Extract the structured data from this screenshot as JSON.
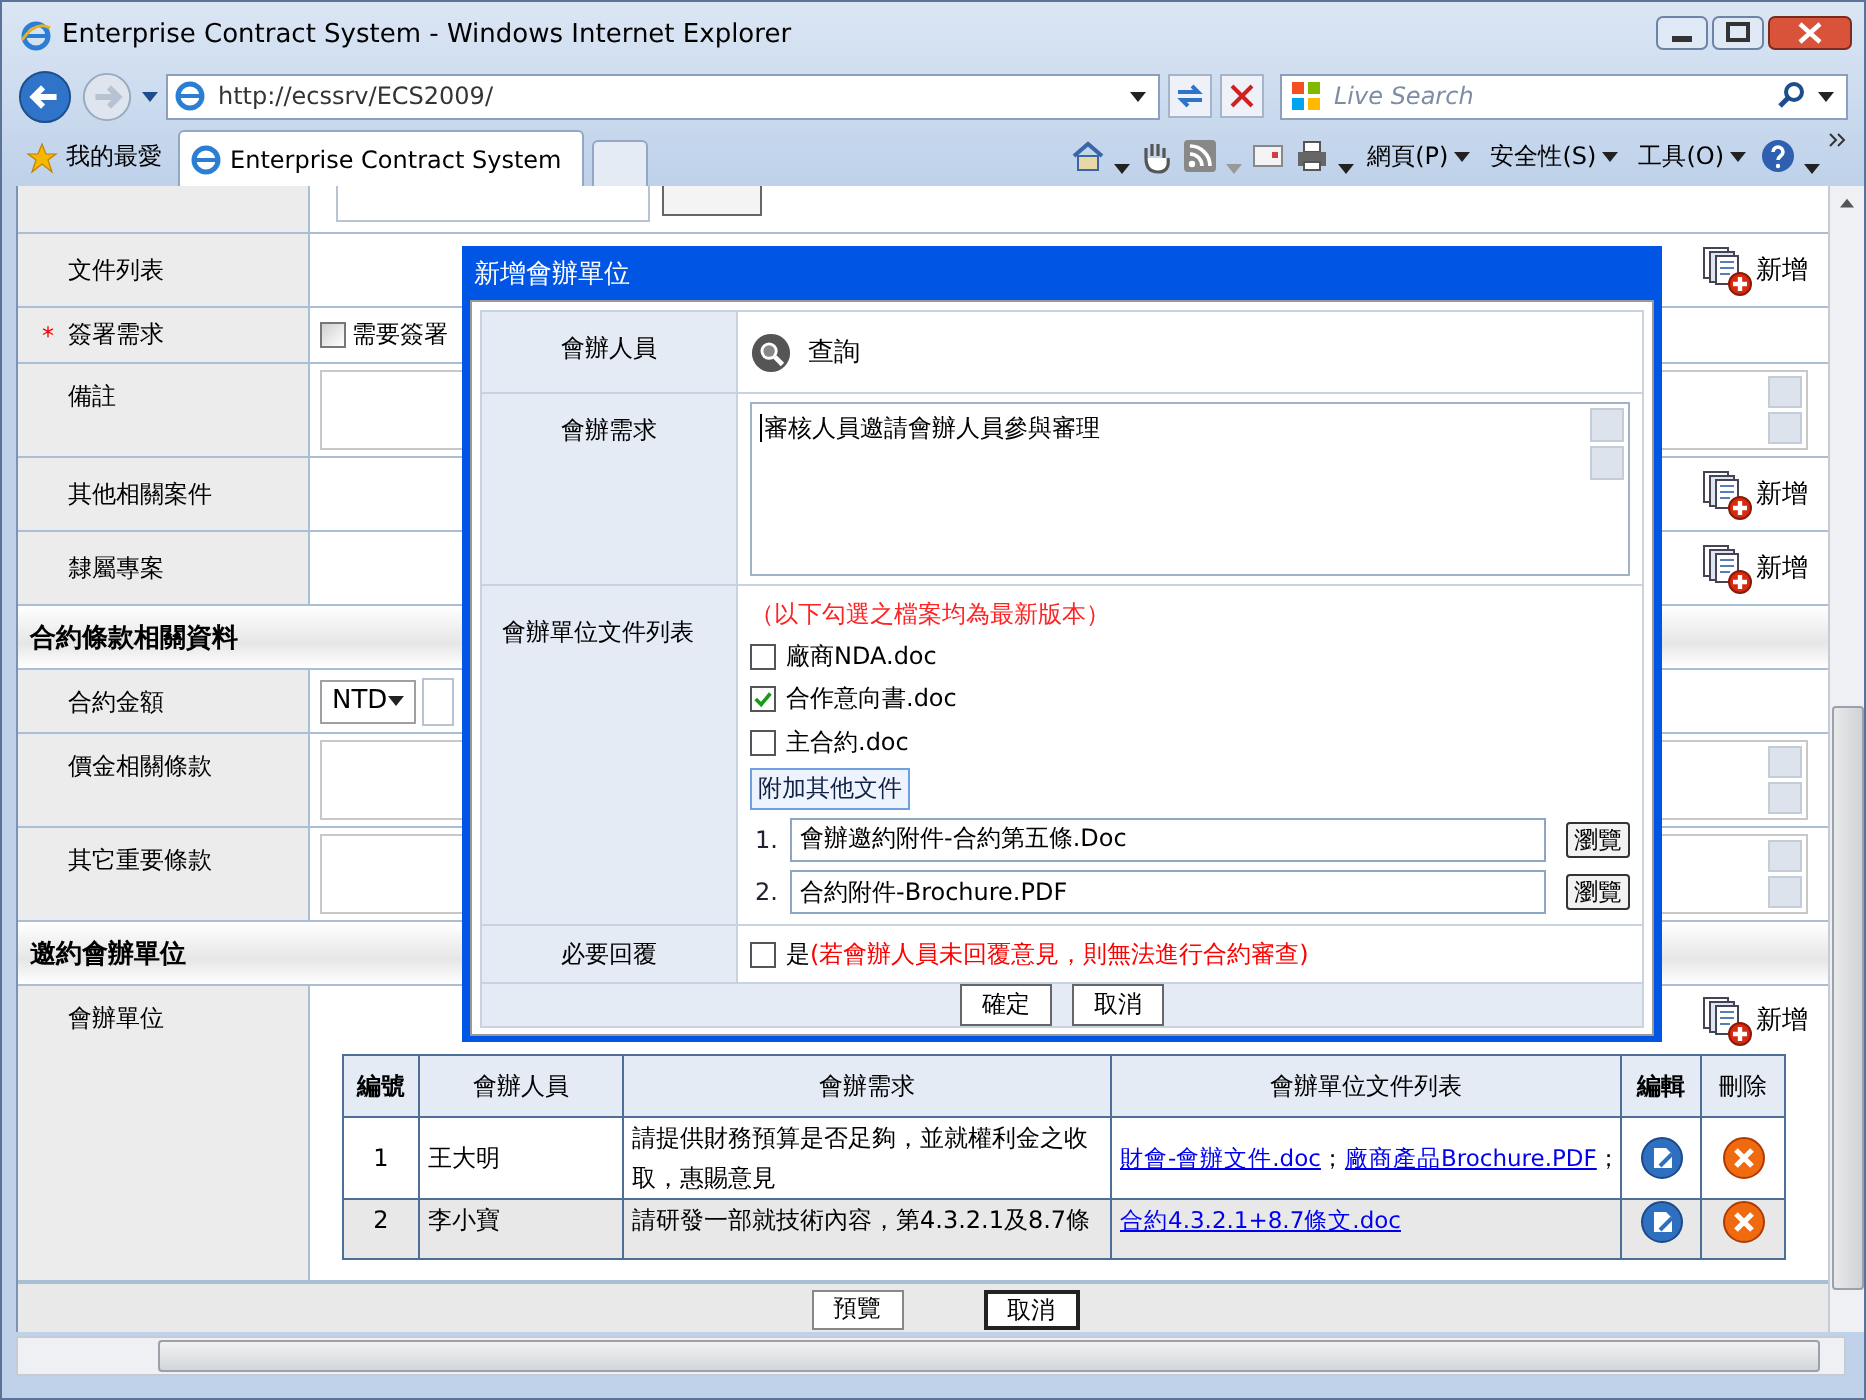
{
  "window": {
    "title": "Enterprise Contract System - Windows Internet Explorer"
  },
  "address_bar": {
    "url": "http://ecssrv/ECS2009/"
  },
  "search": {
    "placeholder": "Live Search"
  },
  "favorites": {
    "label": "我的最愛"
  },
  "tabs": [
    {
      "label": "Enterprise Contract System",
      "selected": true
    }
  ],
  "command_bar": [
    "網頁(P)",
    "安全性(S)",
    "工具(O)"
  ],
  "form": {
    "rows": [
      {
        "kind": "top"
      },
      {
        "kind": "add",
        "label": "文件列表",
        "action": "新增"
      },
      {
        "kind": "checkbox",
        "label": "簽署需求",
        "required_mark": "*",
        "option": "需要簽署",
        "checked": false
      },
      {
        "kind": "textarea",
        "label": "備註"
      },
      {
        "kind": "add",
        "label": "其他相關案件",
        "action": "新增"
      },
      {
        "kind": "add",
        "label": "隸屬專案",
        "action": "新增"
      },
      {
        "kind": "section",
        "label": "合約條款相關資料"
      },
      {
        "kind": "currency",
        "label": "合約金額",
        "value": "NTD"
      },
      {
        "kind": "textarea",
        "label": "價金相關條款"
      },
      {
        "kind": "textarea",
        "label": "其它重要條款"
      },
      {
        "kind": "section",
        "label": "邀約會辦單位"
      },
      {
        "kind": "table",
        "label": "會辦單位",
        "action": "新增"
      }
    ]
  },
  "table": {
    "columns": [
      "編號",
      "會辦人員",
      "會辦需求",
      "會辦單位文件列表",
      "編輯",
      "刪除"
    ],
    "rows": [
      {
        "no": "1",
        "person": "王大明",
        "request": "請提供財務預算是否足夠，並就權利金之收取，惠賜意見",
        "files": [
          {
            "name": "財會-會辦文件.doc",
            "suffix": "；"
          },
          {
            "name": "廠商產品Brochure.PDF",
            "suffix": "；"
          }
        ]
      },
      {
        "no": "2",
        "person": "李小寶",
        "request": "請研發一部就技術內容，第4.3.2.1及8.7條",
        "files": [
          {
            "name": "合約4.3.2.1+8.7條文.doc"
          }
        ]
      }
    ]
  },
  "footer_buttons": [
    "預覽",
    "取消"
  ],
  "dialog": {
    "title": "新增會辦單位",
    "rows": [
      {
        "kind": "search",
        "label": "會辦人員",
        "action": "查詢"
      },
      {
        "kind": "textarea",
        "label": "會辦需求",
        "value": "審核人員邀請會辦人員參與審理"
      },
      {
        "kind": "files",
        "label": "會辦單位文件列表",
        "note": "（以下勾選之檔案均為最新版本）",
        "files": [
          {
            "name": "廠商NDA.doc",
            "checked": false
          },
          {
            "name": "合作意向書.doc",
            "checked": true
          },
          {
            "name": "主合約.doc",
            "checked": false
          }
        ],
        "attach": "附加其他文件",
        "uploads": [
          {
            "index": "1.",
            "value": "會辦邀約附件-合約第五條.Doc",
            "browse": "瀏覽"
          },
          {
            "index": "2.",
            "value": "合約附件-Brochure.PDF",
            "browse": "瀏覽"
          }
        ]
      },
      {
        "kind": "reply",
        "label": "必要回覆",
        "checked": false,
        "option": "是",
        "note": "(若會辦人員未回覆意見，則無法進行合約審查)"
      }
    ],
    "buttons": [
      "確定",
      "取消"
    ]
  }
}
